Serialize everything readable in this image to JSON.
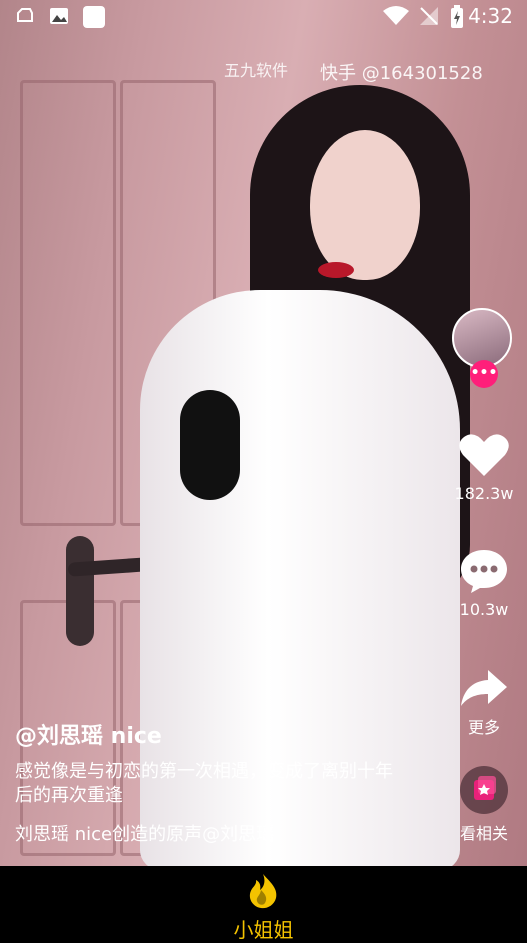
{
  "status_bar": {
    "time": "4:32",
    "icons": [
      "notification-icon",
      "image-icon",
      "app-icon",
      "wifi-icon",
      "no-signal-icon",
      "battery-charging-icon"
    ]
  },
  "watermark": {
    "left": "五九软件",
    "right": "快手 @164301528"
  },
  "side_actions": {
    "like_count": "182.3w",
    "comment_count": "10.3w",
    "share_label": "更多",
    "related_label": "看相关",
    "follow_symbol": "•••"
  },
  "caption": {
    "author": "@刘思瑶 nice",
    "description": "感觉像是与初恋的第一次相遇，变成了离别十年后的再次重逢",
    "music": "刘思瑶 nice创造的原声@刘思瑶"
  },
  "bottom_nav": {
    "label": "小姐姐"
  },
  "colors": {
    "accent": "#f4c300",
    "follow_badge": "#ff1f7a",
    "related_badge": "#e8217a"
  }
}
